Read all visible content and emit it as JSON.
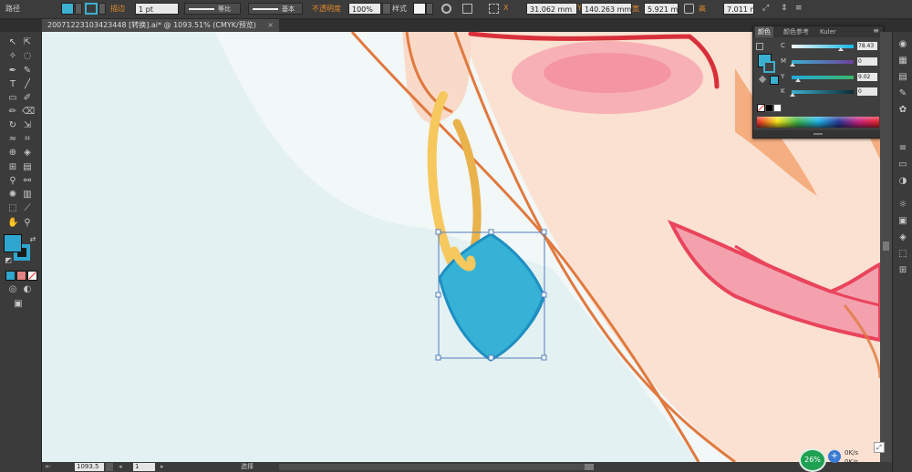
{
  "control_bar": {
    "selection_label": "路径",
    "stroke_label": "描边",
    "stroke_weight": "1 pt",
    "profile_label": "等比",
    "brush_label": "基本",
    "opacity_label": "不透明度",
    "opacity_value": "100%",
    "style_label": "样式",
    "x_value": "31.062 mm",
    "y_value": "140.263 mm",
    "width_value": "5.921 mm",
    "height_value": "7.011 mm",
    "fill_color": "#3cb0d0"
  },
  "document_tab": {
    "title": "20071223103423448 [转换].ai* @ 1093.51% (CMYK/预览)"
  },
  "color_panel": {
    "tabs": [
      "颜色",
      "颜色参考",
      "Kuler"
    ],
    "fill_swatch": "#3cb0d0",
    "channels": [
      {
        "name": "C",
        "value": "78.43",
        "percent": 0.78
      },
      {
        "name": "M",
        "value": "0",
        "percent": 0
      },
      {
        "name": "Y",
        "value": "9.02",
        "percent": 0.09
      },
      {
        "name": "K",
        "value": "0",
        "percent": 0
      }
    ]
  },
  "status_bar": {
    "zoom": "1093.5",
    "page": "1",
    "tool": "选择"
  },
  "navigator": {
    "percent": "26%",
    "up_speed": "0K/s",
    "down_speed": "0K/s"
  },
  "artwork": {
    "background_color": "#e4f1f2",
    "skin_color": "#fbe1d1",
    "outline_color": "#e0793e",
    "hair_color": "#f5ae80",
    "hoop_color": "#f6c85e",
    "pendant_color": "#35b2d5",
    "pendant_shadow": "#1e8fc2",
    "lip_color": "#f06a82",
    "blush_color": "#f48aa0"
  }
}
